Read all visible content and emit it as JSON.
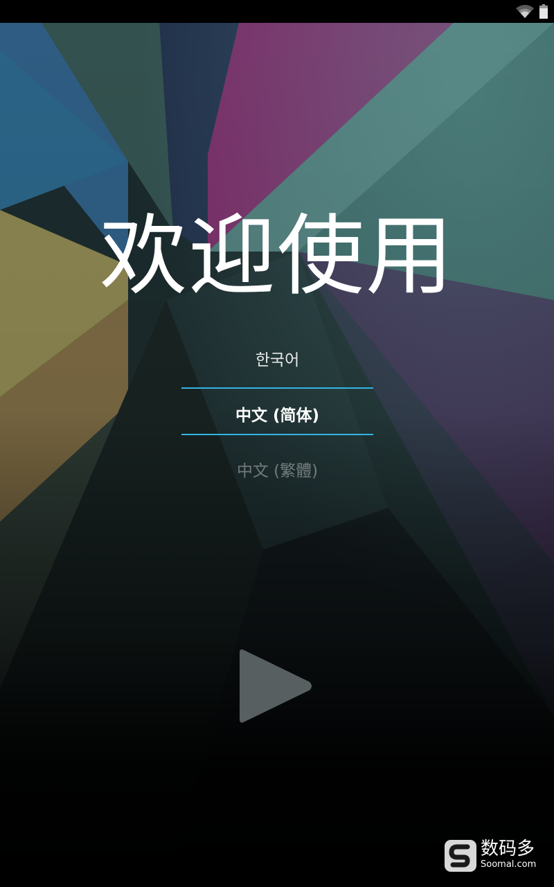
{
  "status_bar": {
    "icons": [
      "wifi-icon",
      "battery-icon"
    ]
  },
  "welcome": {
    "title": "欢迎使用"
  },
  "language_picker": {
    "options": [
      "한국어",
      "中文 (简体)",
      "中文 (繁體)"
    ],
    "selected": "中文 (简体)",
    "accent_color": "#33b5e5"
  },
  "start_button": {
    "icon": "play-icon"
  },
  "watermark": {
    "brand": "数码多",
    "site": "Soomal.com"
  }
}
